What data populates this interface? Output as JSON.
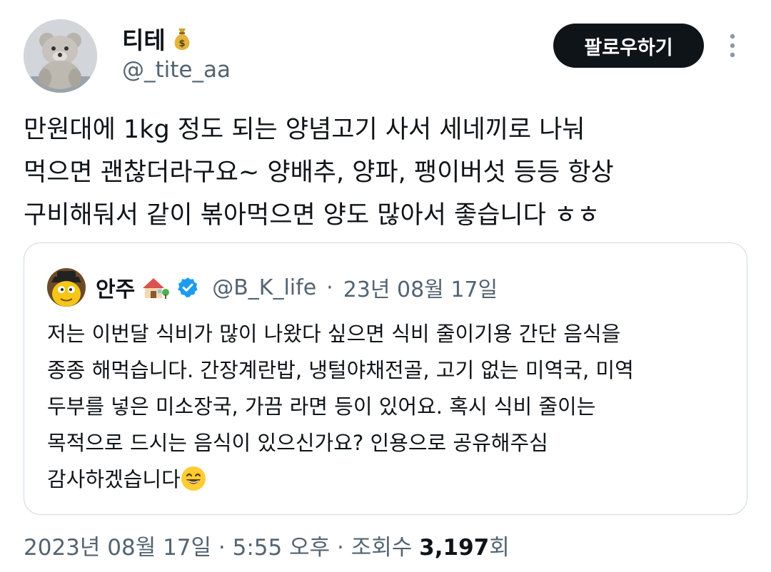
{
  "author": {
    "display_name": "티테",
    "handle": "@_tite_aa",
    "name_emoji": "money-bag-icon"
  },
  "actions": {
    "follow_label": "팔로우하기"
  },
  "tweet": {
    "lines": [
      "만원대에 1kg 정도 되는 양념고기 사서 세네끼로 나눠",
      "먹으면 괜찮더라구요~ 양배추, 양파, 팽이버섯 등등 항상",
      "구비해둬서 같이 볶아먹으면 양도 많아서 좋습니다 ㅎㅎ"
    ]
  },
  "quote": {
    "display_name": "안주",
    "handle": "@B_K_life",
    "separator": "·",
    "date": "23년 08월 17일",
    "lines": [
      "저는 이번달 식비가 많이 나왔다 싶으면 식비 줄이기용 간단 음식을",
      "종종 해먹습니다. 간장계란밥, 냉털야채전골, 고기 없는 미역국, 미역",
      "두부를 넣은 미소장국, 가끔 라면 등이 있어요. 혹시 식비 줄이는",
      "목적으로 드시는 음식이 있으신가요? 인용으로 공유해주심",
      "감사하겠습니다"
    ],
    "end_emoji": "grinning-face-icon"
  },
  "meta": {
    "date": "2023년 08월 17일",
    "time": "5:55 오후",
    "views_label": "조회수",
    "views_count": "3,197",
    "views_suffix": "회",
    "separator": "·"
  },
  "colors": {
    "text": "#0f1419",
    "secondary": "#536471",
    "verified": "#1d9bf0",
    "border": "#cfd9de"
  }
}
